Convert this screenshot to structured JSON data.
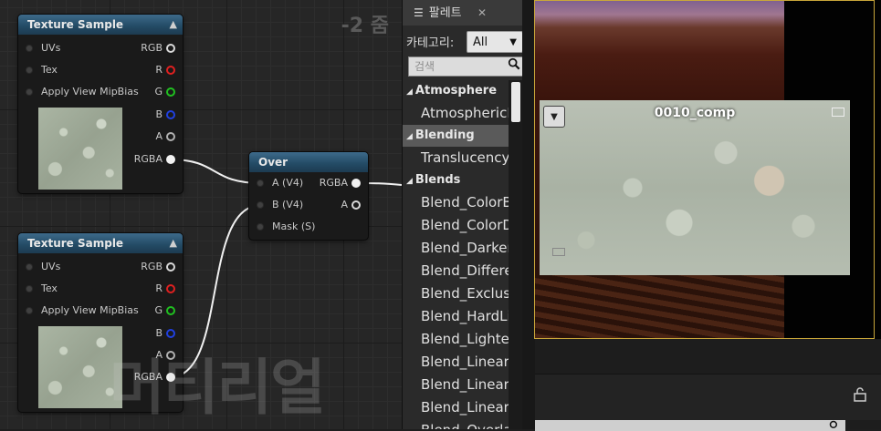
{
  "graph": {
    "zoom_label": "-2 줌",
    "watermark": "머티리얼",
    "nodes": [
      {
        "title": "Texture Sample",
        "inputs": [
          "UVs",
          "Tex",
          "Apply View MipBias"
        ],
        "outputs": [
          "RGB",
          "R",
          "G",
          "B",
          "A",
          "RGBA"
        ]
      },
      {
        "title": "Texture Sample",
        "inputs": [
          "UVs",
          "Tex",
          "Apply View MipBias"
        ],
        "outputs": [
          "RGB",
          "R",
          "G",
          "B",
          "A",
          "RGBA"
        ]
      },
      {
        "title": "Over",
        "inputs": [
          "A (V4)",
          "B (V4)",
          "Mask (S)"
        ],
        "outputs": [
          "RGBA",
          "A"
        ]
      }
    ],
    "pin_colors": {
      "RGB": "#e0e0e0",
      "R": "#e02020",
      "G": "#20c020",
      "B": "#2040e0",
      "A": "#b0b0b0",
      "RGBA": "#ffffff"
    }
  },
  "palette": {
    "tab_label": "팔레트",
    "category_label": "카테고리:",
    "category_value": "All",
    "search_placeholder": "검색",
    "items": [
      {
        "kind": "header",
        "label": "Atmosphere"
      },
      {
        "kind": "item",
        "label": "AtmosphericFogColor"
      },
      {
        "kind": "header",
        "label": "Blending",
        "selected": true
      },
      {
        "kind": "item",
        "label": "TranslucencyBlend"
      },
      {
        "kind": "header",
        "label": "Blends"
      },
      {
        "kind": "item",
        "label": "Blend_ColorBurn"
      },
      {
        "kind": "item",
        "label": "Blend_ColorDodge"
      },
      {
        "kind": "item",
        "label": "Blend_Darken"
      },
      {
        "kind": "item",
        "label": "Blend_Difference"
      },
      {
        "kind": "item",
        "label": "Blend_Exclusion"
      },
      {
        "kind": "item",
        "label": "Blend_HardLight"
      },
      {
        "kind": "item",
        "label": "Blend_Lighten"
      },
      {
        "kind": "item",
        "label": "Blend_LinearBurn"
      },
      {
        "kind": "item",
        "label": "Blend_LinearDodge"
      },
      {
        "kind": "item",
        "label": "Blend_LinearLight"
      },
      {
        "kind": "item",
        "label": "Blend_Overlay"
      }
    ]
  },
  "preview": {
    "title": "0010_comp"
  }
}
